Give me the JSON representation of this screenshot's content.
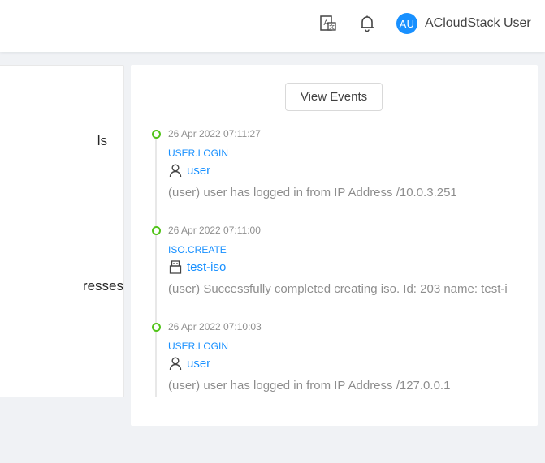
{
  "header": {
    "user": {
      "initials": "AU",
      "name": "ACloudStack User"
    }
  },
  "left_card": {
    "fragments": [
      "ls",
      "resses"
    ]
  },
  "events_card": {
    "view_events_label": "View Events",
    "events": [
      {
        "time": "26 Apr 2022 07:11:27",
        "type": "USER.LOGIN",
        "resource_icon": "user-icon",
        "resource": "user",
        "description": "(user) user has logged in from IP Address /10.0.3.251"
      },
      {
        "time": "26 Apr 2022 07:11:00",
        "type": "ISO.CREATE",
        "resource_icon": "usb-icon",
        "resource": "test-iso",
        "description": "(user) Successfully completed creating iso. Id: 203 name: test-i"
      },
      {
        "time": "26 Apr 2022 07:10:03",
        "type": "USER.LOGIN",
        "resource_icon": "user-icon",
        "resource": "user",
        "description": "(user) user has logged in from IP Address /127.0.0.1"
      }
    ]
  },
  "colors": {
    "accent": "#1890ff",
    "timeline_dot": "#52c41a",
    "background": "#f0f2f5"
  }
}
